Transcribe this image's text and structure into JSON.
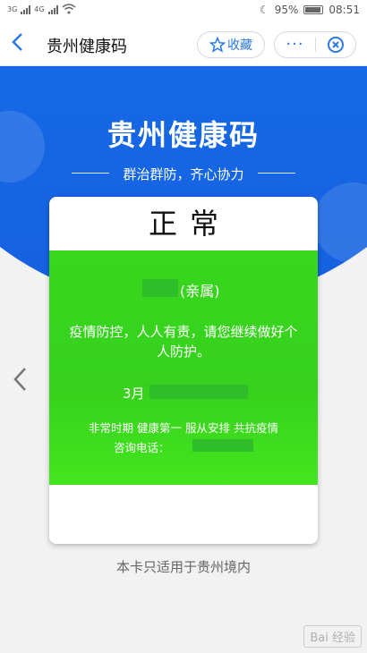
{
  "status_bar": {
    "time": "08:51",
    "battery": "95%",
    "network_1": "3G",
    "network_2": "4G"
  },
  "nav": {
    "title": "贵州健康码",
    "favorite_label": "收藏",
    "more_label": "···"
  },
  "hero": {
    "title": "贵州健康码",
    "subtitle": "群治群防，齐心协力"
  },
  "card": {
    "status": "正常",
    "relation": "(亲属)",
    "message": "疫情防控，人人有责，请您继续做好个人防护。",
    "date_prefix": "3月",
    "notice": "非常时期 健康第一 服从安排 共抗疫情",
    "phone_label": "咨询电话：",
    "card_color": "#38d61e"
  },
  "footer": {
    "note": "本卡只适用于贵州境内"
  },
  "watermark": {
    "text": "Bai 经验"
  },
  "colors": {
    "accent": "#2a7ae2",
    "hero_blue": "#1976ee",
    "healthy_green": "#38d61e"
  }
}
